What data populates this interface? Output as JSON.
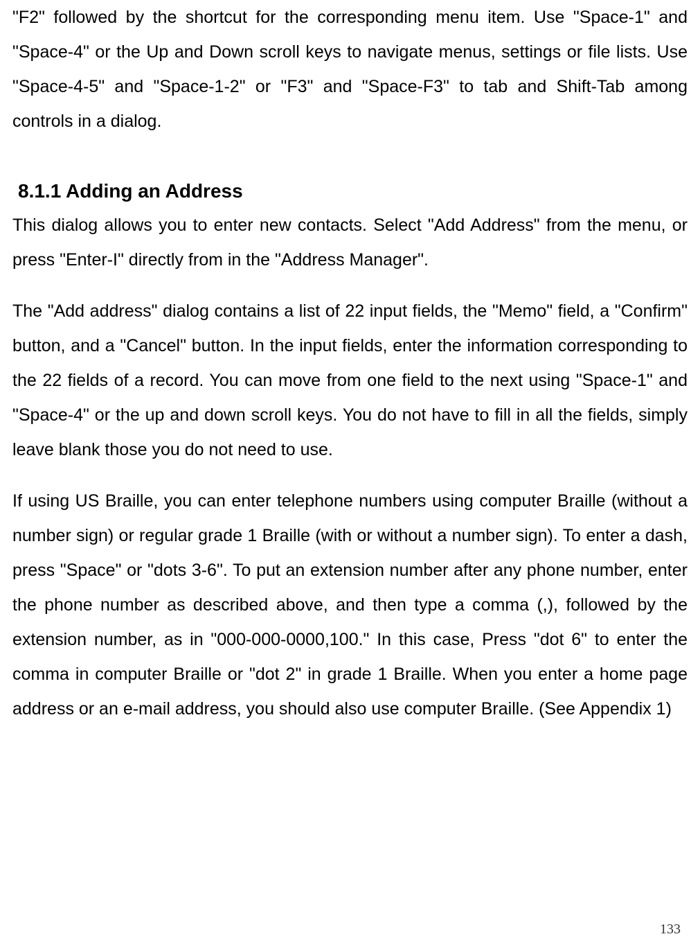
{
  "paragraphs": {
    "p1": "\"F2\" followed by the shortcut for the corresponding menu item. Use \"Space-1\" and \"Space-4\" or the Up and Down scroll keys to navigate menus, settings or file lists. Use \"Space-4-5\" and \"Space-1-2\" or \"F3\" and \"Space-F3\" to tab and Shift-Tab among controls in a dialog.",
    "heading": "8.1.1 Adding an Address",
    "p2": "This dialog allows you to enter new contacts. Select \"Add Address\" from the menu, or press \"Enter-I\" directly from in the \"Address Manager\".",
    "p3": "The \"Add address\" dialog contains a list of 22 input fields, the \"Memo\" field, a \"Confirm\" button, and a \"Cancel\" button. In the input fields, enter the information corresponding to the 22 fields of a record. You can move from one field to the next using \"Space-1\" and \"Space-4\" or the up and down scroll keys. You do not have to fill in all the fields, simply leave blank those you do not need to use.",
    "p4": "If using US Braille, you can enter telephone numbers using computer Braille (without a number sign) or regular grade 1 Braille (with or without a number sign). To enter a dash, press \"Space\" or \"dots 3-6\". To put an extension number after any phone number, enter the phone number as described above, and then type a comma (,), followed by the extension number, as in \"000-000-0000,100.\" In this case, Press \"dot 6\" to enter the comma in computer Braille or \"dot 2\" in grade 1 Braille. When you enter a home page address or an e-mail address, you should also use computer Braille. (See Appendix 1)"
  },
  "page_number": "133"
}
